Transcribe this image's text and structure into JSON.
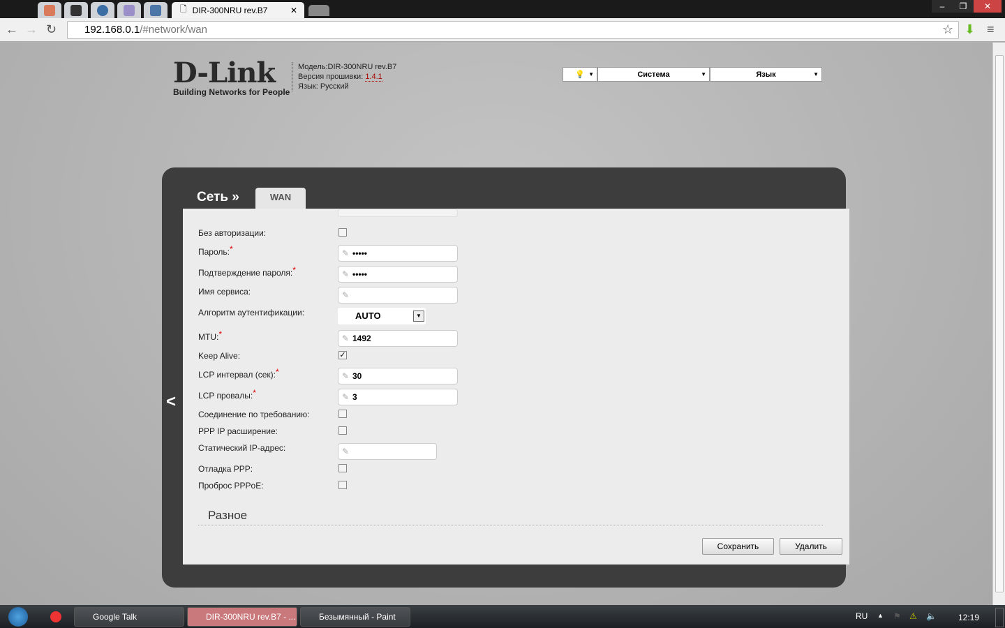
{
  "browser": {
    "active_tab": "DIR-300NRU rev.B7",
    "pinned_tabs": [
      "hand-icon",
      "cloud-icon",
      "forward-icon",
      "logo-icon",
      "vk-icon"
    ],
    "url_host": "192.168.0.1",
    "url_path": "/#network/wan",
    "window_buttons": [
      "–",
      "❐",
      "✕"
    ]
  },
  "header": {
    "logo": "D-Link",
    "tagline": "Building Networks for People",
    "model": "Модель:DIR-300NRU rev.B7",
    "fw_label": "Версия прошивки: ",
    "fw_version": "1.4.1",
    "lang": "Язык: Русский",
    "menu": {
      "system": "Система",
      "language": "Язык"
    }
  },
  "breadcrumb": {
    "section": "Сеть »",
    "tab": "WAN"
  },
  "form": {
    "no_auth": "Без авторизации:",
    "password": "Пароль:",
    "password_value": "•••••",
    "confirm": "Подтверждение пароля:",
    "confirm_value": "•••••",
    "service": "Имя сервиса:",
    "auth_alg": "Алгоритм аутентификации:",
    "auth_alg_value": "AUTO",
    "mtu": "MTU:",
    "mtu_value": "1492",
    "keepalive": "Keep Alive:",
    "lcp_interval": "LCP интервал (сек):",
    "lcp_interval_value": "30",
    "lcp_fail": "LCP провалы:",
    "lcp_fail_value": "3",
    "on_demand": "Соединение по требованию:",
    "ppp_ip_ext": "PPP IP расширение:",
    "static_ip": "Статический IP-адрес:",
    "ppp_debug": "Отладка PPP:",
    "pppoe_passthrough": "Проброс PPPoE:",
    "req": "*"
  },
  "misc_title": "Разное",
  "buttons": {
    "save": "Сохранить",
    "delete": "Удалить"
  },
  "taskbar": {
    "items": [
      "Google Talk",
      "DIR-300NRU rev.B7 - ...",
      "Безымянный - Paint"
    ],
    "lang": "RU",
    "time": "12:19"
  }
}
